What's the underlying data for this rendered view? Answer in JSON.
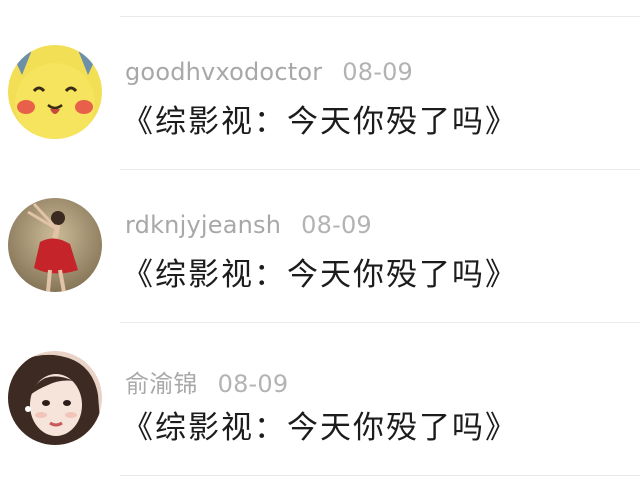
{
  "comments": [
    {
      "username": "goodhvxodoctor",
      "date": "08-09",
      "text": "《综影视：今天你殁了吗》",
      "avatar_icon": "pikachu-avatar"
    },
    {
      "username": "rdknjyjeansh",
      "date": "08-09",
      "text": "《综影视：今天你殁了吗》",
      "avatar_icon": "dancer-avatar"
    },
    {
      "username": "俞渝锦",
      "date": "08-09",
      "text": "《综影视：今天你殁了吗》",
      "avatar_icon": "girl-portrait-avatar"
    }
  ],
  "colors": {
    "username": "#a8a8a8",
    "text": "#1c1c1c",
    "divider": "#e9e9e9"
  }
}
